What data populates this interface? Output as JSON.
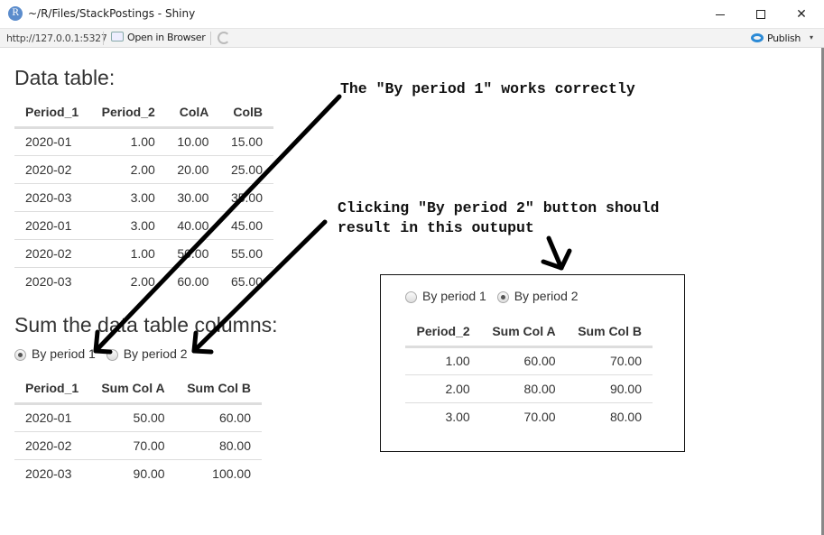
{
  "window": {
    "app_icon": "R",
    "title": "~/R/Files/StackPostings - Shiny",
    "controls": {
      "minimize": "minimize-icon",
      "maximize": "maximize-icon",
      "close": "✕"
    }
  },
  "toolbar": {
    "url": "http://127.0.0.1:5327",
    "open_in_browser": "Open in Browser",
    "refresh_icon": "refresh-icon",
    "publish": "Publish",
    "publish_caret": "▾"
  },
  "data_table": {
    "heading": "Data table:",
    "columns": [
      "Period_1",
      "Period_2",
      "ColA",
      "ColB"
    ],
    "rows": [
      [
        "2020-01",
        "1.00",
        "10.00",
        "15.00"
      ],
      [
        "2020-02",
        "2.00",
        "20.00",
        "25.00"
      ],
      [
        "2020-03",
        "3.00",
        "30.00",
        "35.00"
      ],
      [
        "2020-01",
        "3.00",
        "40.00",
        "45.00"
      ],
      [
        "2020-02",
        "1.00",
        "50.00",
        "55.00"
      ],
      [
        "2020-03",
        "2.00",
        "60.00",
        "65.00"
      ]
    ]
  },
  "sum_section": {
    "heading": "Sum the data table columns:",
    "radio_options": [
      "By period 1",
      "By period 2"
    ],
    "selected": "By period 1",
    "columns": [
      "Period_1",
      "Sum Col A",
      "Sum Col B"
    ],
    "rows": [
      [
        "2020-01",
        "50.00",
        "60.00"
      ],
      [
        "2020-02",
        "70.00",
        "80.00"
      ],
      [
        "2020-03",
        "90.00",
        "100.00"
      ]
    ]
  },
  "expected_output": {
    "radio_options": [
      "By period 1",
      "By period 2"
    ],
    "selected": "By period 2",
    "columns": [
      "Period_2",
      "Sum Col A",
      "Sum Col B"
    ],
    "rows": [
      [
        "1.00",
        "60.00",
        "70.00"
      ],
      [
        "2.00",
        "80.00",
        "90.00"
      ],
      [
        "3.00",
        "70.00",
        "80.00"
      ]
    ]
  },
  "annotations": {
    "note1": "The \"By period 1\" works correctly",
    "note2": "Clicking \"By period 2\" button should\nresult in this outuput"
  }
}
